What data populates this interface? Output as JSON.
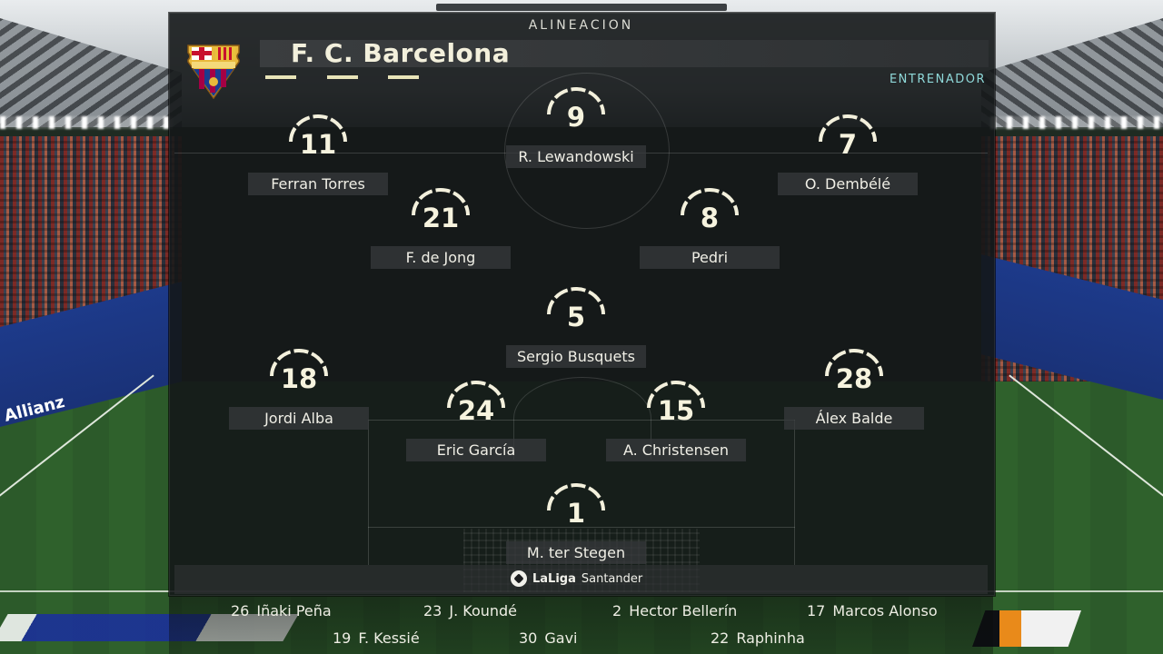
{
  "panel": {
    "title": "ALINEACION",
    "team_name": "F. C. Barcelona",
    "coach_link": "ENTRENADOR",
    "crest_text": "FCB",
    "sponsor": "LaLiga",
    "sponsor_suffix": "Santander"
  },
  "colors": {
    "accent_cream": "#f3f0dc",
    "coach_link": "#8fd9d9",
    "panel_bg": "#141718"
  },
  "lineup": [
    {
      "number": "9",
      "name": "R. Lewandowski"
    },
    {
      "number": "11",
      "name": "Ferran Torres"
    },
    {
      "number": "7",
      "name": "O. Dembélé"
    },
    {
      "number": "21",
      "name": "F. de Jong"
    },
    {
      "number": "8",
      "name": "Pedri"
    },
    {
      "number": "5",
      "name": "Sergio Busquets"
    },
    {
      "number": "18",
      "name": "Jordi Alba"
    },
    {
      "number": "28",
      "name": "Álex Balde"
    },
    {
      "number": "24",
      "name": "Eric García"
    },
    {
      "number": "15",
      "name": "A. Christensen"
    },
    {
      "number": "1",
      "name": "M. ter Stegen"
    }
  ],
  "substitutes": [
    {
      "number": "26",
      "name": "Iñaki Peña"
    },
    {
      "number": "23",
      "name": "J. Koundé"
    },
    {
      "number": "2",
      "name": "Hector Bellerín"
    },
    {
      "number": "17",
      "name": "Marcos Alonso"
    },
    {
      "number": "19",
      "name": "F. Kessié"
    },
    {
      "number": "30",
      "name": "Gavi"
    },
    {
      "number": "22",
      "name": "Raphinha"
    }
  ],
  "background_text": {
    "board_left": "Allianz"
  }
}
